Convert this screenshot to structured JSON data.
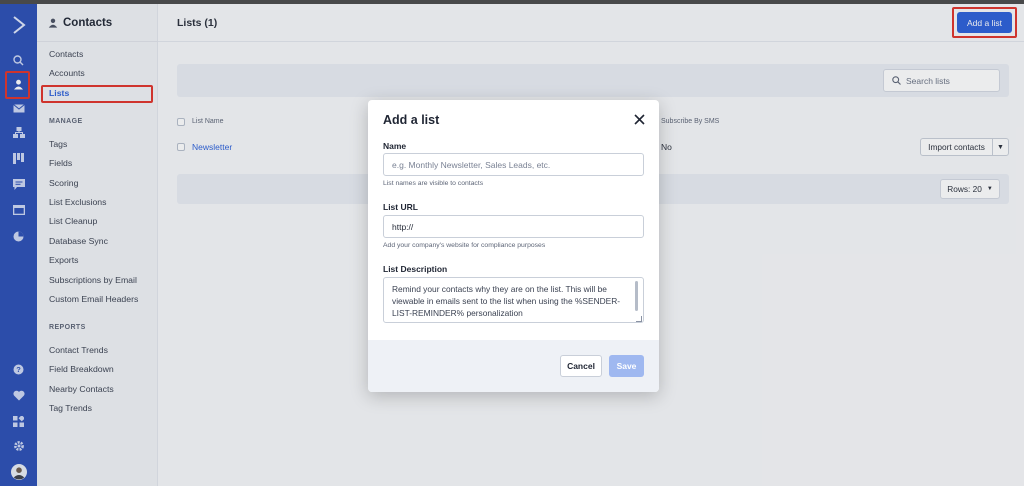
{
  "colors": {
    "brand": "#2b4fb5",
    "accent": "#2b5fd9",
    "highlight": "#e0332a",
    "save_disabled": "#9fb8f0"
  },
  "rail": {
    "icons": [
      "logo-chevron-icon",
      "search-icon",
      "contacts-icon",
      "mail-icon",
      "org-chart-icon",
      "kanban-icon",
      "chat-icon",
      "window-icon",
      "pie-chart-icon",
      "help-icon",
      "heart-icon",
      "apps-icon",
      "gear-icon",
      "user-avatar"
    ]
  },
  "subnav": {
    "title": "Contacts",
    "items_top": [
      "Contacts",
      "Accounts",
      "Lists"
    ],
    "active": "Lists",
    "manage_heading": "MANAGE",
    "manage_items": [
      "Tags",
      "Fields",
      "Scoring",
      "List Exclusions",
      "List Cleanup",
      "Database Sync",
      "Exports",
      "Subscriptions by Email",
      "Custom Email Headers"
    ],
    "reports_heading": "REPORTS",
    "reports_items": [
      "Contact Trends",
      "Field Breakdown",
      "Nearby Contacts",
      "Tag Trends"
    ]
  },
  "header": {
    "title": "Lists (1)",
    "add_button": "Add a list"
  },
  "search": {
    "placeholder": "Search lists"
  },
  "table": {
    "columns": [
      "List Name",
      "Subscribe By SMS"
    ],
    "rows": [
      {
        "name": "Newsletter",
        "sms": "No",
        "action": "Import contacts"
      }
    ]
  },
  "pagination": {
    "rows_label": "Rows: 20"
  },
  "modal": {
    "title": "Add a list",
    "name_label": "Name",
    "name_placeholder": "e.g. Monthly Newsletter, Sales Leads, etc.",
    "name_help": "List names are visible to contacts",
    "url_label": "List URL",
    "url_value": "http://",
    "url_help": "Add your company's website for compliance purposes",
    "desc_label": "List Description",
    "desc_placeholder": "Remind your contacts why they are on the list. This will be viewable in emails sent to the list when using the %SENDER-LIST-REMINDER% personalization",
    "cancel": "Cancel",
    "save": "Save"
  }
}
